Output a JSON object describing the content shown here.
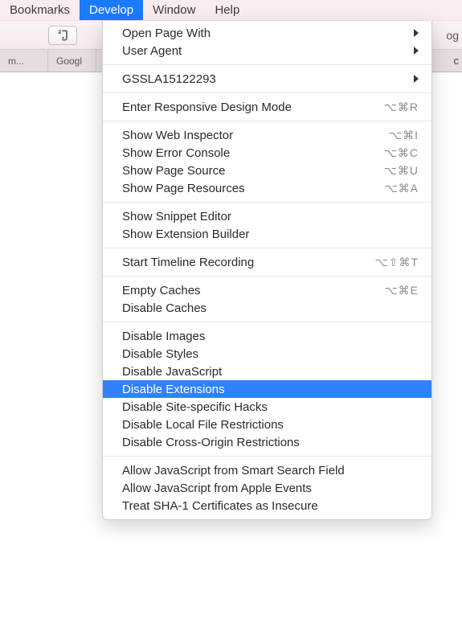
{
  "menubar": {
    "items": [
      {
        "label": "Bookmarks",
        "active": false
      },
      {
        "label": "Develop",
        "active": true
      },
      {
        "label": "Window",
        "active": false
      },
      {
        "label": "Help",
        "active": false
      }
    ]
  },
  "toolbar": {
    "iconName": "evernote-icon",
    "trailing": "og"
  },
  "tabs": {
    "items": [
      "m...",
      "Googl"
    ],
    "trailing": "c"
  },
  "dropdown": {
    "groups": [
      [
        {
          "label": "Open Page With",
          "submenu": true
        },
        {
          "label": "User Agent",
          "submenu": true
        }
      ],
      [
        {
          "label": "GSSLA15122293",
          "submenu": true
        }
      ],
      [
        {
          "label": "Enter Responsive Design Mode",
          "shortcut": "⌥⌘R"
        }
      ],
      [
        {
          "label": "Show Web Inspector",
          "shortcut": "⌥⌘I"
        },
        {
          "label": "Show Error Console",
          "shortcut": "⌥⌘C"
        },
        {
          "label": "Show Page Source",
          "shortcut": "⌥⌘U"
        },
        {
          "label": "Show Page Resources",
          "shortcut": "⌥⌘A"
        }
      ],
      [
        {
          "label": "Show Snippet Editor"
        },
        {
          "label": "Show Extension Builder"
        }
      ],
      [
        {
          "label": "Start Timeline Recording",
          "shortcut": "⌥⇧⌘T"
        }
      ],
      [
        {
          "label": "Empty Caches",
          "shortcut": "⌥⌘E"
        },
        {
          "label": "Disable Caches"
        }
      ],
      [
        {
          "label": "Disable Images"
        },
        {
          "label": "Disable Styles"
        },
        {
          "label": "Disable JavaScript"
        },
        {
          "label": "Disable Extensions",
          "selected": true
        },
        {
          "label": "Disable Site-specific Hacks"
        },
        {
          "label": "Disable Local File Restrictions"
        },
        {
          "label": "Disable Cross-Origin Restrictions"
        }
      ],
      [
        {
          "label": "Allow JavaScript from Smart Search Field"
        },
        {
          "label": "Allow JavaScript from Apple Events"
        },
        {
          "label": "Treat SHA-1 Certificates as Insecure"
        }
      ]
    ]
  }
}
